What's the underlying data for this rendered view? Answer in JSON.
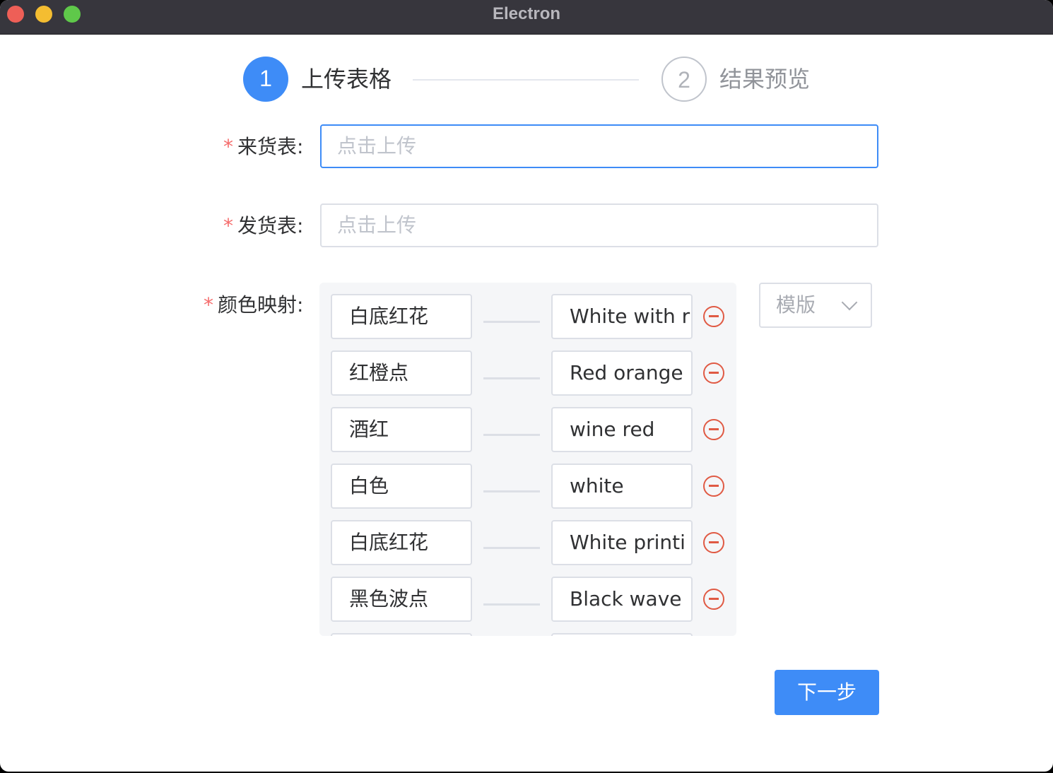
{
  "window": {
    "title": "Electron"
  },
  "steps": [
    {
      "number": "1",
      "label": "上传表格"
    },
    {
      "number": "2",
      "label": "结果预览"
    }
  ],
  "form": {
    "required_mark": "*",
    "incoming": {
      "label": "来货表:",
      "placeholder": "点击上传"
    },
    "outgoing": {
      "label": "发货表:",
      "placeholder": "点击上传"
    },
    "color_mapping": {
      "label": "颜色映射:",
      "rows": [
        {
          "source": "白底红花",
          "target": "White with r"
        },
        {
          "source": "红橙点",
          "target": "Red orange"
        },
        {
          "source": "酒红",
          "target": "wine red"
        },
        {
          "source": "白色",
          "target": "white"
        },
        {
          "source": "白底红花",
          "target": "White printi"
        },
        {
          "source": "黑色波点",
          "target": "Black wave"
        }
      ]
    },
    "template_select": {
      "placeholder": "模版",
      "icon": "chevron-down-icon"
    }
  },
  "actions": {
    "next_label": "下一步"
  },
  "colors": {
    "primary": "#3e8cf7",
    "danger": "#e05a44",
    "required": "#f56c6c"
  }
}
